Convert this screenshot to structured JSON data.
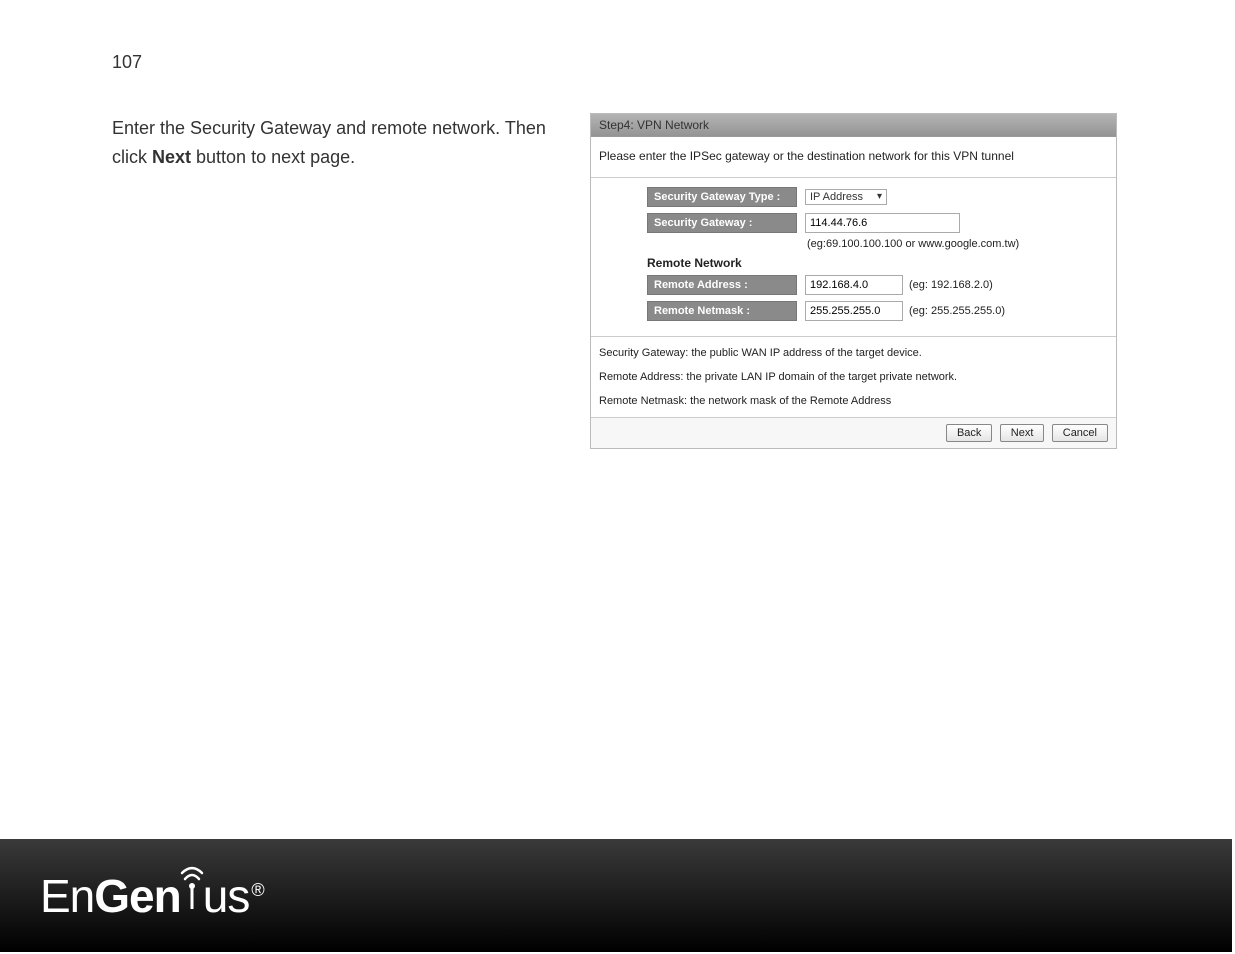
{
  "page": {
    "number": "107",
    "instruction_pre": "Enter the Security Gateway and remote network. Then click ",
    "instruction_bold": "Next",
    "instruction_post": " button to next page."
  },
  "panel": {
    "title": "Step4: VPN Network",
    "description": "Please enter the IPSec gateway or the destination network for this VPN tunnel",
    "form": {
      "gateway_type": {
        "label": "Security Gateway Type :",
        "value": "IP Address"
      },
      "gateway": {
        "label": "Security Gateway :",
        "value": "114.44.76.6",
        "hint": "(eg:69.100.100.100 or www.google.com.tw)"
      },
      "remote_section": "Remote Network",
      "remote_address": {
        "label": "Remote Address :",
        "value": "192.168.4.0",
        "hint": "(eg: 192.168.2.0)"
      },
      "remote_netmask": {
        "label": "Remote Netmask :",
        "value": "255.255.255.0",
        "hint": "(eg: 255.255.255.0)"
      }
    },
    "help": {
      "line1": "Security Gateway: the public WAN IP address of the target device.",
      "line2": "Remote Address: the private LAN IP domain of the target private network.",
      "line3": "Remote Netmask: the network mask of the Remote Address"
    },
    "buttons": {
      "back": "Back",
      "next": "Next",
      "cancel": "Cancel"
    }
  },
  "logo": {
    "text_pre": "En",
    "text_mid_bold": "Gen",
    "text_dot_char": "i",
    "text_post": "us"
  }
}
